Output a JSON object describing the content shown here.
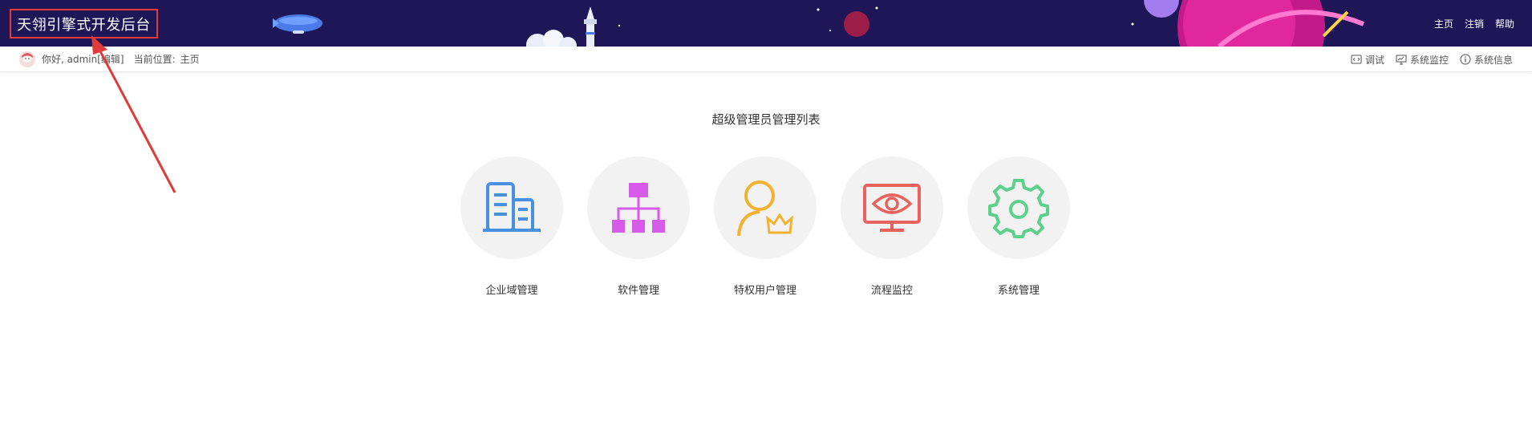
{
  "header": {
    "brand_title": "天翎引擎式开发后台",
    "nav": [
      {
        "label": "主页"
      },
      {
        "label": "注销"
      },
      {
        "label": "帮助"
      }
    ],
    "colors": {
      "background": "#1e1656",
      "annotation": "#e03a3a"
    }
  },
  "subbar": {
    "greeting": "你好, admin",
    "edit_label": "[编辑]",
    "location_label": "当前位置:",
    "location_value": "主页",
    "tools": [
      {
        "label": "调试",
        "icon": "code-icon"
      },
      {
        "label": "系统监控",
        "icon": "monitor-icon"
      },
      {
        "label": "系统信息",
        "icon": "info-icon"
      }
    ]
  },
  "main": {
    "title": "超级管理员管理列表",
    "cards": [
      {
        "label": "企业域管理",
        "icon": "building-icon",
        "color": "#4a90e2"
      },
      {
        "label": "软件管理",
        "icon": "hierarchy-icon",
        "color": "#d55be8"
      },
      {
        "label": "特权用户管理",
        "icon": "user-crown-icon",
        "color": "#f2b230"
      },
      {
        "label": "流程监控",
        "icon": "eye-monitor-icon",
        "color": "#e8625e"
      },
      {
        "label": "系统管理",
        "icon": "gear-icon",
        "color": "#5dd08c"
      }
    ]
  }
}
